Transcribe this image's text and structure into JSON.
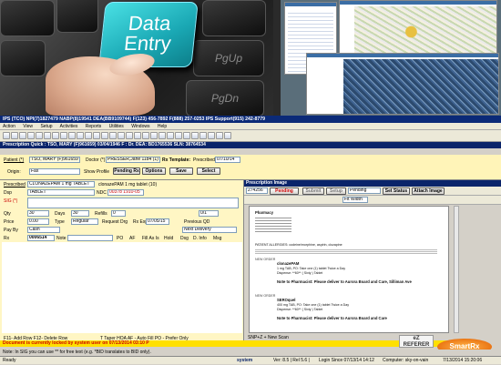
{
  "hero": {
    "key_label_line1": "Data",
    "key_label_line2": "Entry",
    "keys": [
      "PgUp",
      "PgDn"
    ]
  },
  "info_bar": "IPS (TCO) NPI(7)1827479 NABP(8)19541 DEA(BB9109744) F(123) 456-7892 F(888) 257-0253 IPS Support(915) 242-8779",
  "menu": [
    "Action",
    "View",
    "Setup",
    "Activities",
    "Reports",
    "Utilities",
    "Windows",
    "Help"
  ],
  "prescription_quick": {
    "title": "Prescription Quick : TSO, MARY (F)961659) 03/04/1946 F : Dr. DEA: BD1765536 SLN: 38764534",
    "patient_label": "Patient (*)",
    "patient_value": "TSO, MARY (F)961659",
    "doctor_label": "Doctor (*)",
    "doctor_value": "PRESSER,Jane 1184 (1)",
    "prescribed_label": "Prescribed",
    "prescribed_value": "07/10/14",
    "rx_template": "Rx Template:",
    "origin_label": "Origin:",
    "origin_value": "Fax",
    "show_profile": "Show Profile",
    "pending_button": "Pending Rx",
    "options_button": "Options",
    "save_button": "Save",
    "select_button": "Select"
  },
  "left_form": {
    "prescribed_drug_label": "Prescribed",
    "prescribed_drug_value": "CLONAZEPAM 1 mg TABLET",
    "drug_alt": "clonazePAM 1 mg tablet (10)",
    "dispensed_label": "Dsp",
    "dispensed_value": "TABLET",
    "ndc_label": "NDC",
    "ndc_value": "00378 1910-05",
    "sig_label": "SIG (*)",
    "rows": [
      "Qty",
      "Days",
      "Refills",
      "Price",
      "Pay By",
      "Rx"
    ],
    "qty": "30",
    "days": "30",
    "refills": "0",
    "day_ref": "0/1",
    "price": "0.00",
    "type_label": "Type",
    "type_value": "Regular",
    "request_drug": "Request Drg",
    "rx_exp": "Rx Exp",
    "rx_exp_value": "07/05/15",
    "previous_qd": "Previous QD",
    "pay_by": "Cash",
    "delivery": "Next Delivery",
    "rx_number": "0006514",
    "note_label": "Note",
    "flags": [
      "PO",
      "AF",
      "Fill As Is",
      "Hold",
      "Dsg",
      "D. Info",
      "Msg"
    ],
    "footer_line1": "F11- Add Row   F12- Delete Row",
    "footer_line2": "Note: In SIG you can use ** for free text (e.g. *BID translates to BID only).",
    "footer_flags": "T Taper  HOA  AF - Auto Fill  PO - Prefer Only"
  },
  "image_panel": {
    "title": "Prescription Image",
    "id_value": "274256",
    "toolbar1": [
      "Pending",
      "Submit",
      "Setup",
      "Pending",
      "Set Status",
      "Attach Image"
    ],
    "zoom": "Fit Width",
    "pharmacy_name": "Pharmacy",
    "patient_allergies": "PATIENT ALLERGIES: codeine/morphine, aspirin, clozapine",
    "new_order_1_header": "NEW ORDER",
    "new_order_1_drug": "clonazePAM",
    "new_order_1_sig": "1 mg TAB, PO: Take one (1) tablet Twice a Day",
    "new_order_1_dispense": "Dispense: **60** ( Sixty ) Tablet",
    "new_order_1_note": "Note to Pharmacist: Please deliver to Aurora Board and Care, Silliman Ave",
    "new_order_2_header": "NEW ORDER",
    "new_order_2_drug": "SEROquel",
    "new_order_2_sig": "400 mg TAB, PO: Take one (1) tablet Twice a Day",
    "new_order_2_dispense": "Dispense: **60** ( Sixty ) Tablet",
    "new_order_2_note": "Note to Pharmacist: Please deliver to Aurora Board and Care",
    "page_nav": "SNP+Z + New Scan"
  },
  "lock_message": "Document is currently locked by system user on 07/13/2014 03:10 P",
  "logo": "eZ REFERER",
  "smart_badge": "SmartRx",
  "status_bar": {
    "left": "Ready",
    "center": "system",
    "ver": "Ver: 8.5 | Rel 5.6 |",
    "login": "Login Since 07/13/14 14:12",
    "computer": "Computer: sky-on-vain",
    "time": "7/13/2014 15:20:06"
  }
}
